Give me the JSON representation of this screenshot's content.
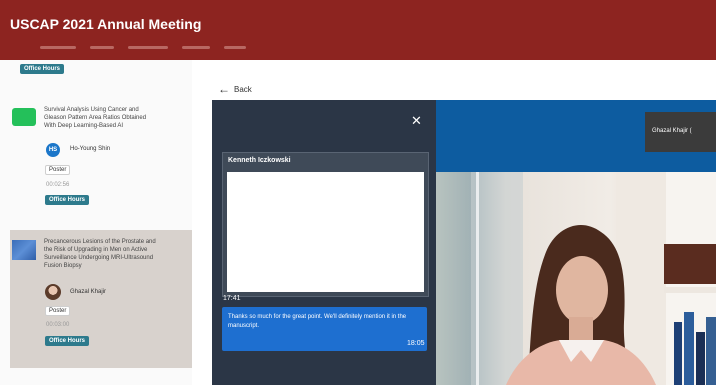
{
  "header": {
    "title": "USCAP 2021 Annual Meeting"
  },
  "sidebar": {
    "top_office_hours": "Office Hours",
    "cards": [
      {
        "title_lines": [
          "Survival Analysis Using Cancer and",
          "Gleason Pattern Area Ratios Obtained",
          "With Deep Learning-Based AI"
        ],
        "avatar_initials": "HS",
        "author": "Ho-Young Shin",
        "tag": "Poster",
        "time": "00:02:56",
        "button": "Office Hours"
      },
      {
        "title_lines": [
          "Precancerous Lesions of the Prostate and",
          "the Risk of Upgrading in Men on Active",
          "Surveillance Undergoing MRI-Ultrasound",
          "Fusion Biopsy"
        ],
        "author": "Ghazal Khajir",
        "tag": "Poster",
        "time": "00:03:00",
        "button": "Office Hours"
      }
    ]
  },
  "nav": {
    "back": "Back"
  },
  "chat": {
    "participant": "Kenneth Iczkowski",
    "left_time": "17:41",
    "message": "Thanks so much for the great point. We'll definitely mention it in the manuscript.",
    "message_time": "18:05",
    "close_symbol": "✕"
  },
  "video": {
    "tile_name": "Ghazal Khajir ("
  },
  "colors": {
    "header": "#8d2420",
    "accent": "#2d7a8c",
    "chat_bg": "#2b3646",
    "message": "#1e6fd0"
  }
}
